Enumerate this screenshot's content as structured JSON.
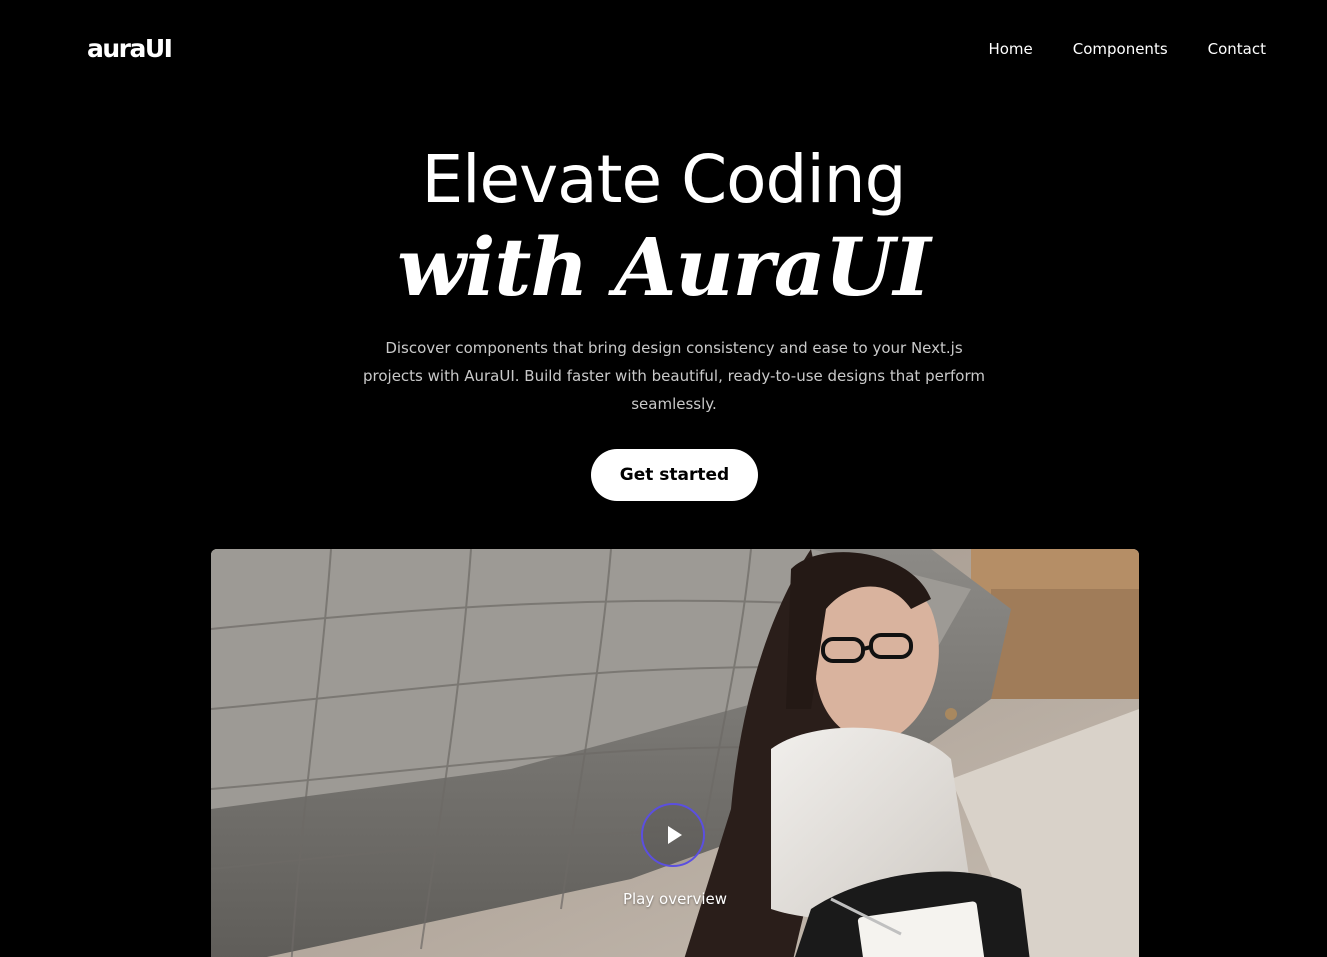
{
  "header": {
    "logo_text": "auraUI",
    "nav": [
      {
        "label": "Home"
      },
      {
        "label": "Components"
      },
      {
        "label": "Contact"
      }
    ]
  },
  "hero": {
    "title_line1": "Elevate Coding",
    "title_line2": "with AuraUI",
    "description": "Discover components that bring design consistency and ease to your Next.js projects with AuraUI. Build faster with beautiful, ready-to-use designs that perform seamlessly.",
    "cta_label": "Get started"
  },
  "media": {
    "play_label": "Play overview",
    "play_icon": "play-icon",
    "ring_color": "#5b4fe0"
  },
  "colors": {
    "background": "#000000",
    "text": "#ffffff",
    "muted_text": "#c9c9c9",
    "button_bg": "#ffffff",
    "button_text": "#000000"
  }
}
